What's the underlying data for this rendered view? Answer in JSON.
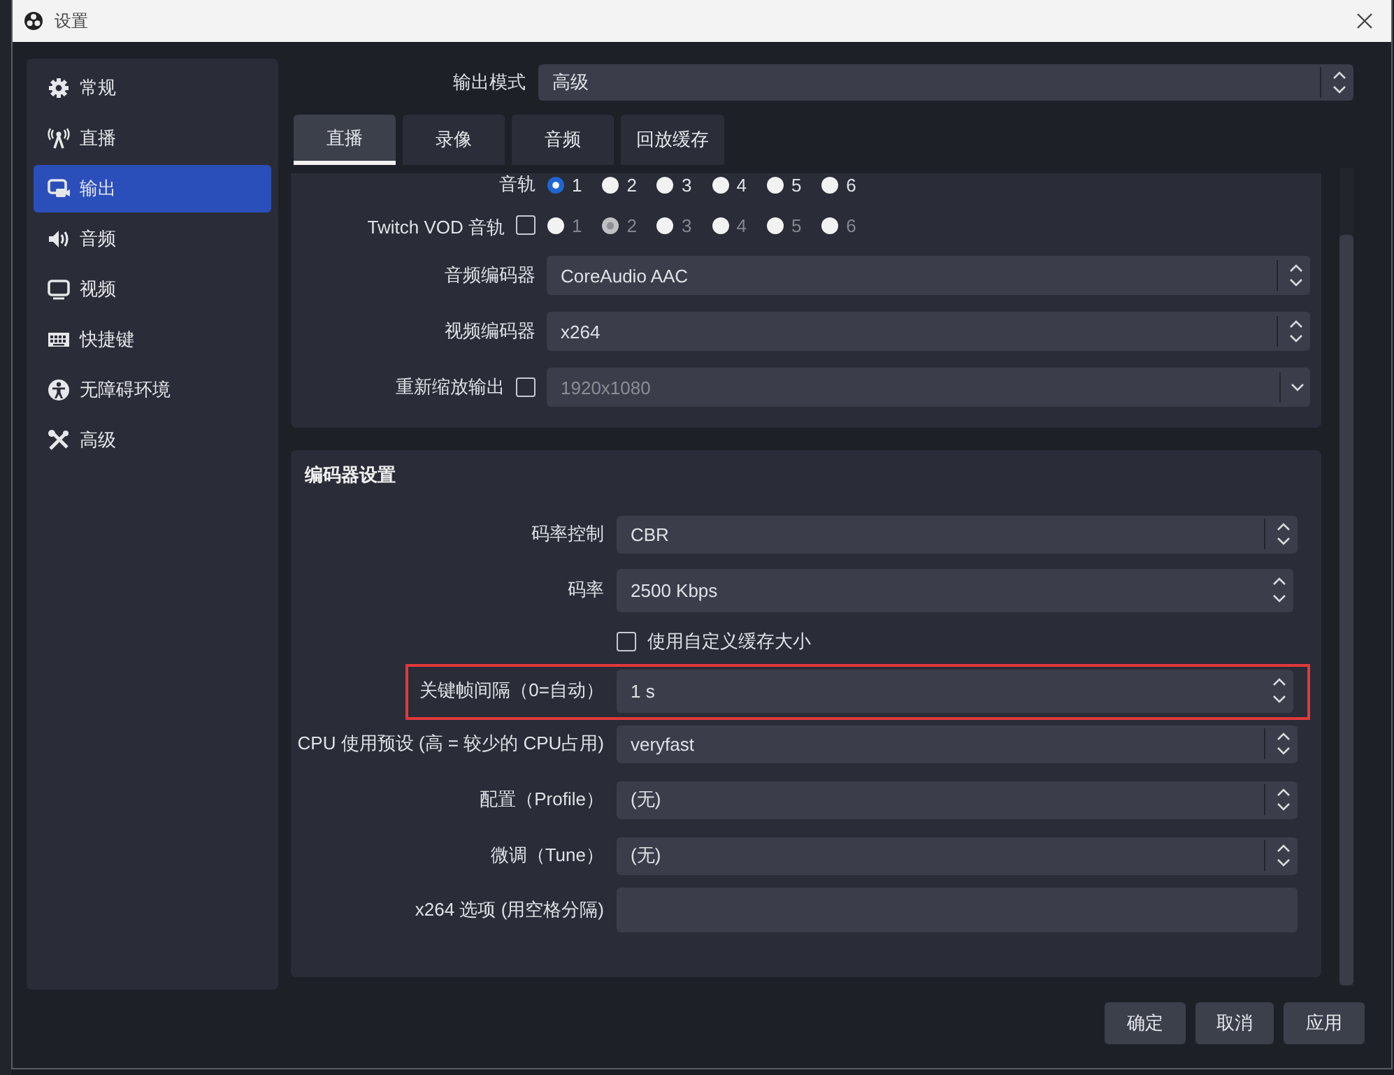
{
  "window": {
    "title": "设置"
  },
  "sidebar": {
    "items": [
      {
        "label": "常规",
        "selected": false
      },
      {
        "label": "直播",
        "selected": false
      },
      {
        "label": "输出",
        "selected": true
      },
      {
        "label": "音频",
        "selected": false
      },
      {
        "label": "视频",
        "selected": false
      },
      {
        "label": "快捷键",
        "selected": false
      },
      {
        "label": "无障碍环境",
        "selected": false
      },
      {
        "label": "高级",
        "selected": false
      }
    ]
  },
  "output_mode": {
    "label": "输出模式",
    "value": "高级"
  },
  "tabs": [
    {
      "label": "直播",
      "selected": true
    },
    {
      "label": "录像",
      "selected": false
    },
    {
      "label": "音频",
      "selected": false
    },
    {
      "label": "回放缓存",
      "selected": false
    }
  ],
  "audio_track": {
    "label": "音轨",
    "disabled": false,
    "options": [
      {
        "label": "1",
        "selected": true
      },
      {
        "label": "2",
        "selected": false
      },
      {
        "label": "3",
        "selected": false
      },
      {
        "label": "4",
        "selected": false
      },
      {
        "label": "5",
        "selected": false
      },
      {
        "label": "6",
        "selected": false
      }
    ]
  },
  "twitch_vod_track": {
    "label": "Twitch VOD 音轨",
    "checked": false,
    "disabled": true,
    "options": [
      {
        "label": "1",
        "selected": false
      },
      {
        "label": "2",
        "selected": true
      },
      {
        "label": "3",
        "selected": false
      },
      {
        "label": "4",
        "selected": false
      },
      {
        "label": "5",
        "selected": false
      },
      {
        "label": "6",
        "selected": false
      }
    ]
  },
  "stream_rows": [
    {
      "kind": "combo",
      "label": "音频编码器",
      "value": "CoreAudio AAC"
    },
    {
      "kind": "combo",
      "label": "视频编码器",
      "value": "x264"
    },
    {
      "kind": "check_dropdown",
      "label": "重新缩放输出",
      "checked": false,
      "value": "1920x1080",
      "disabled": true
    }
  ],
  "encoder_settings": {
    "title": "编码器设置",
    "rows": [
      {
        "kind": "combo",
        "label": "码率控制",
        "value": "CBR"
      },
      {
        "kind": "spin",
        "label": "码率",
        "value": "2500 Kbps"
      },
      {
        "kind": "checkbox",
        "label": "使用自定义缓存大小",
        "checked": false
      },
      {
        "kind": "spin",
        "label": "关键帧间隔（0=自动）",
        "value": "1 s",
        "highlighted": true
      },
      {
        "kind": "combo",
        "label": "CPU 使用预设 (高 = 较少的 CPU占用)",
        "value": "veryfast"
      },
      {
        "kind": "combo",
        "label": "配置（Profile）",
        "value": "(无)"
      },
      {
        "kind": "combo",
        "label": "微调（Tune）",
        "value": "(无)"
      },
      {
        "kind": "text",
        "label": "x264 选项 (用空格分隔)"
      }
    ]
  },
  "buttons": [
    {
      "label": "确定"
    },
    {
      "label": "取消"
    },
    {
      "label": "应用"
    }
  ]
}
